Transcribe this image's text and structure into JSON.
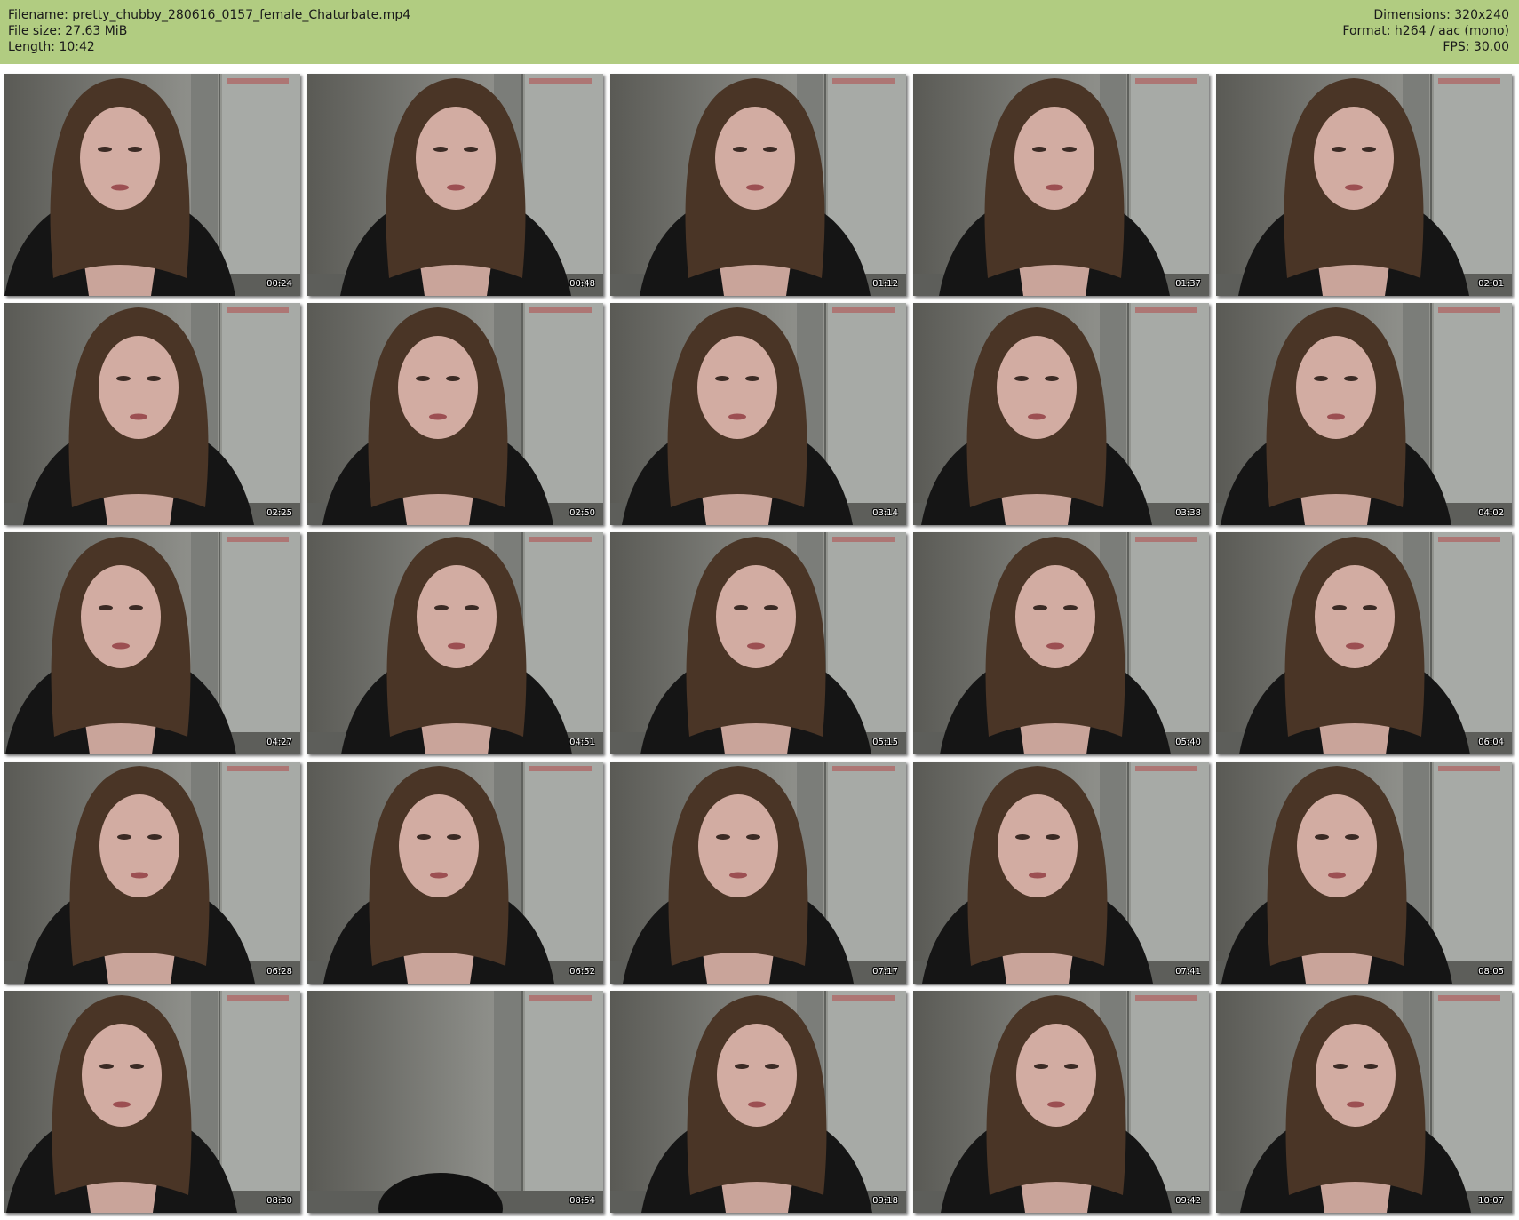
{
  "header": {
    "filename": "Filename: pretty_chubby_280616_0157_female_Chaturbate.mp4",
    "filesize": "File size: 27.63 MiB",
    "length": "Length: 10:42",
    "dimensions": "Dimensions: 320x240",
    "format": "Format: h264 / aac (mono)",
    "fps": "FPS: 30.00"
  },
  "thumbnails": [
    {
      "time": "00:24"
    },
    {
      "time": "00:48"
    },
    {
      "time": "01:12"
    },
    {
      "time": "01:37"
    },
    {
      "time": "02:01"
    },
    {
      "time": "02:25"
    },
    {
      "time": "02:50"
    },
    {
      "time": "03:14"
    },
    {
      "time": "03:38"
    },
    {
      "time": "04:02"
    },
    {
      "time": "04:27"
    },
    {
      "time": "04:51"
    },
    {
      "time": "05:15"
    },
    {
      "time": "05:40"
    },
    {
      "time": "06:04"
    },
    {
      "time": "06:28"
    },
    {
      "time": "06:52"
    },
    {
      "time": "07:17"
    },
    {
      "time": "07:41"
    },
    {
      "time": "08:05"
    },
    {
      "time": "08:30"
    },
    {
      "time": "08:54"
    },
    {
      "time": "09:18"
    },
    {
      "time": "09:42"
    },
    {
      "time": "10:07"
    }
  ]
}
